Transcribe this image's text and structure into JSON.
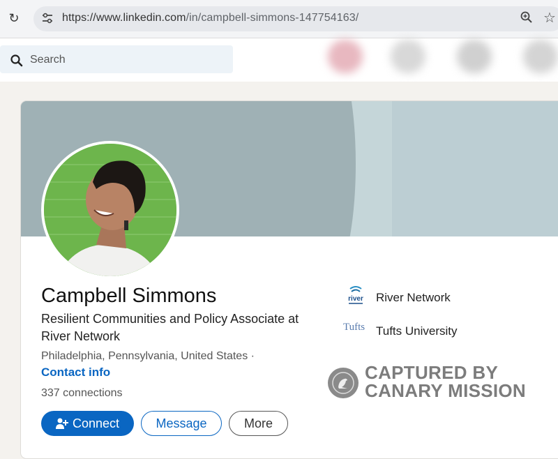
{
  "browser": {
    "url_prefix": "https://www.linkedin.com",
    "url_path": "/in/campbell-simmons-147754163/"
  },
  "search": {
    "placeholder": "Search"
  },
  "profile": {
    "name": "Campbell Simmons",
    "headline": "Resilient Communities and Policy Associate at River Network",
    "location": "Philadelphia, Pennsylvania, United States ·",
    "contact_info": "Contact info",
    "connections": "337 connections",
    "actions": {
      "connect": "Connect",
      "message": "Message",
      "more": "More"
    },
    "organizations": [
      {
        "name": "River Network",
        "logo": "river-network-logo"
      },
      {
        "name": "Tufts University",
        "logo": "tufts-logo",
        "logo_text": "Tufts"
      }
    ]
  },
  "watermark": {
    "line1": "CAPTURED BY",
    "line2": "CANARY MISSION"
  },
  "colors": {
    "linkedin_blue": "#0a66c2",
    "banner": "#9fb1b5",
    "background": "#f4f2ee"
  }
}
